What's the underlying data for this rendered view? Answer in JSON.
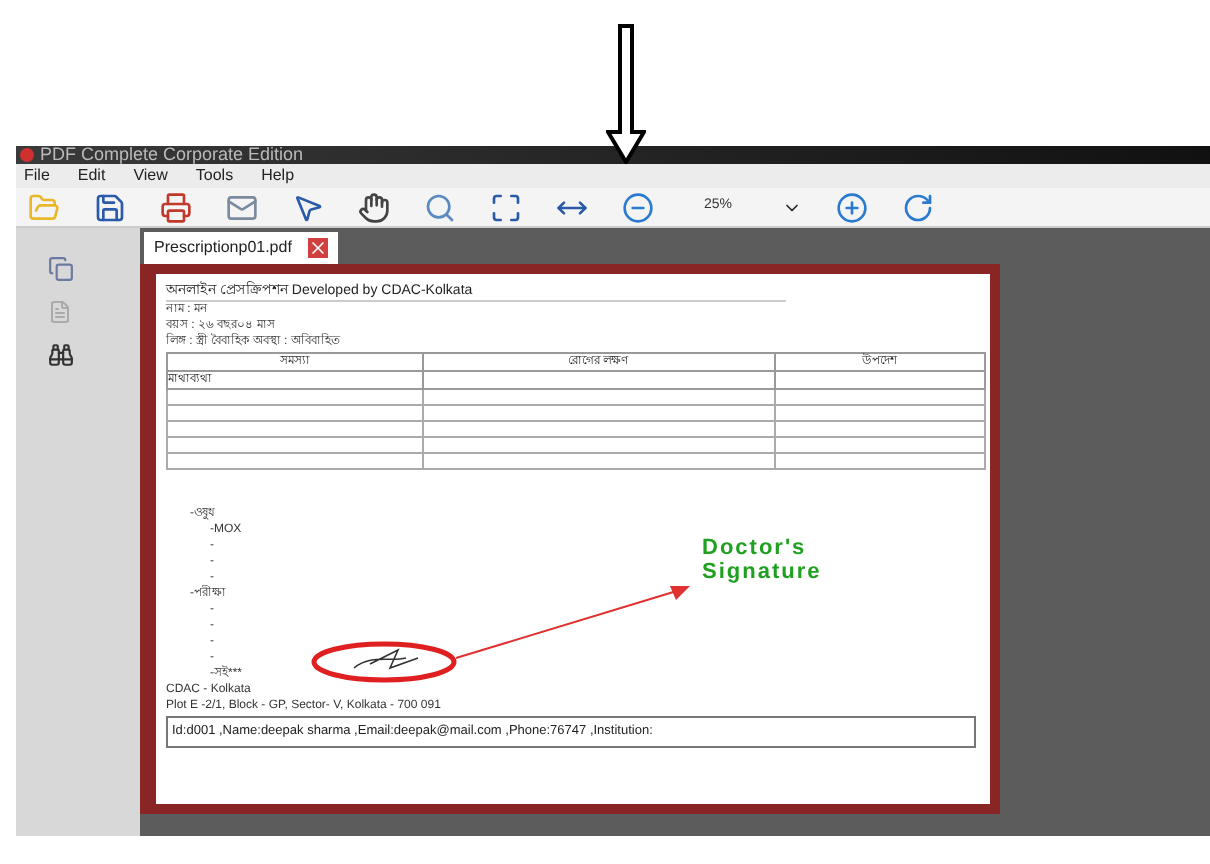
{
  "window": {
    "title": "PDF Complete Corporate Edition"
  },
  "menu": [
    "File",
    "Edit",
    "View",
    "Tools",
    "Help"
  ],
  "toolbar": {
    "zoom": "25%"
  },
  "tabs": [
    {
      "label": "Prescriptionp01.pdf",
      "selected": true
    }
  ],
  "document": {
    "header": "অনলাইন প্রেসক্রিপশন Developed by CDAC-Kolkata",
    "lines": [
      "নাম : মন",
      "বয়স : ২৬ বছর০৪ মাস",
      "লিঙ্গ : স্ত্রী বৈবাহিক অবস্থা : অবিবাহিত"
    ],
    "table": {
      "columns": [
        "সমস্যা",
        "রোগের লক্ষণ",
        "উপদেশ"
      ],
      "rows": [
        [
          "মাথাব্যথা"
        ]
      ]
    },
    "outline": [
      {
        "text": "-ওষুধ",
        "children": [
          {
            "text": "-MOX"
          },
          {
            "text": "-"
          },
          {
            "text": "-"
          },
          {
            "text": "-"
          }
        ]
      },
      {
        "text": "-পরীক্ষা",
        "children": [
          {
            "text": "-"
          },
          {
            "text": "-"
          },
          {
            "text": "-"
          },
          {
            "text": "-"
          },
          {
            "text": "-সই***"
          }
        ]
      }
    ],
    "footer": [
      "CDAC - Kolkata",
      "Plot E -2/1, Block - GP, Sector- V, Kolkata - 700 091"
    ],
    "info_box": "Id:d001 ,Name:deepak sharma ,Email:deepak@mail.com ,Phone:76747 ,Institution:"
  },
  "annotation": {
    "label": "Doctor's Signature"
  }
}
